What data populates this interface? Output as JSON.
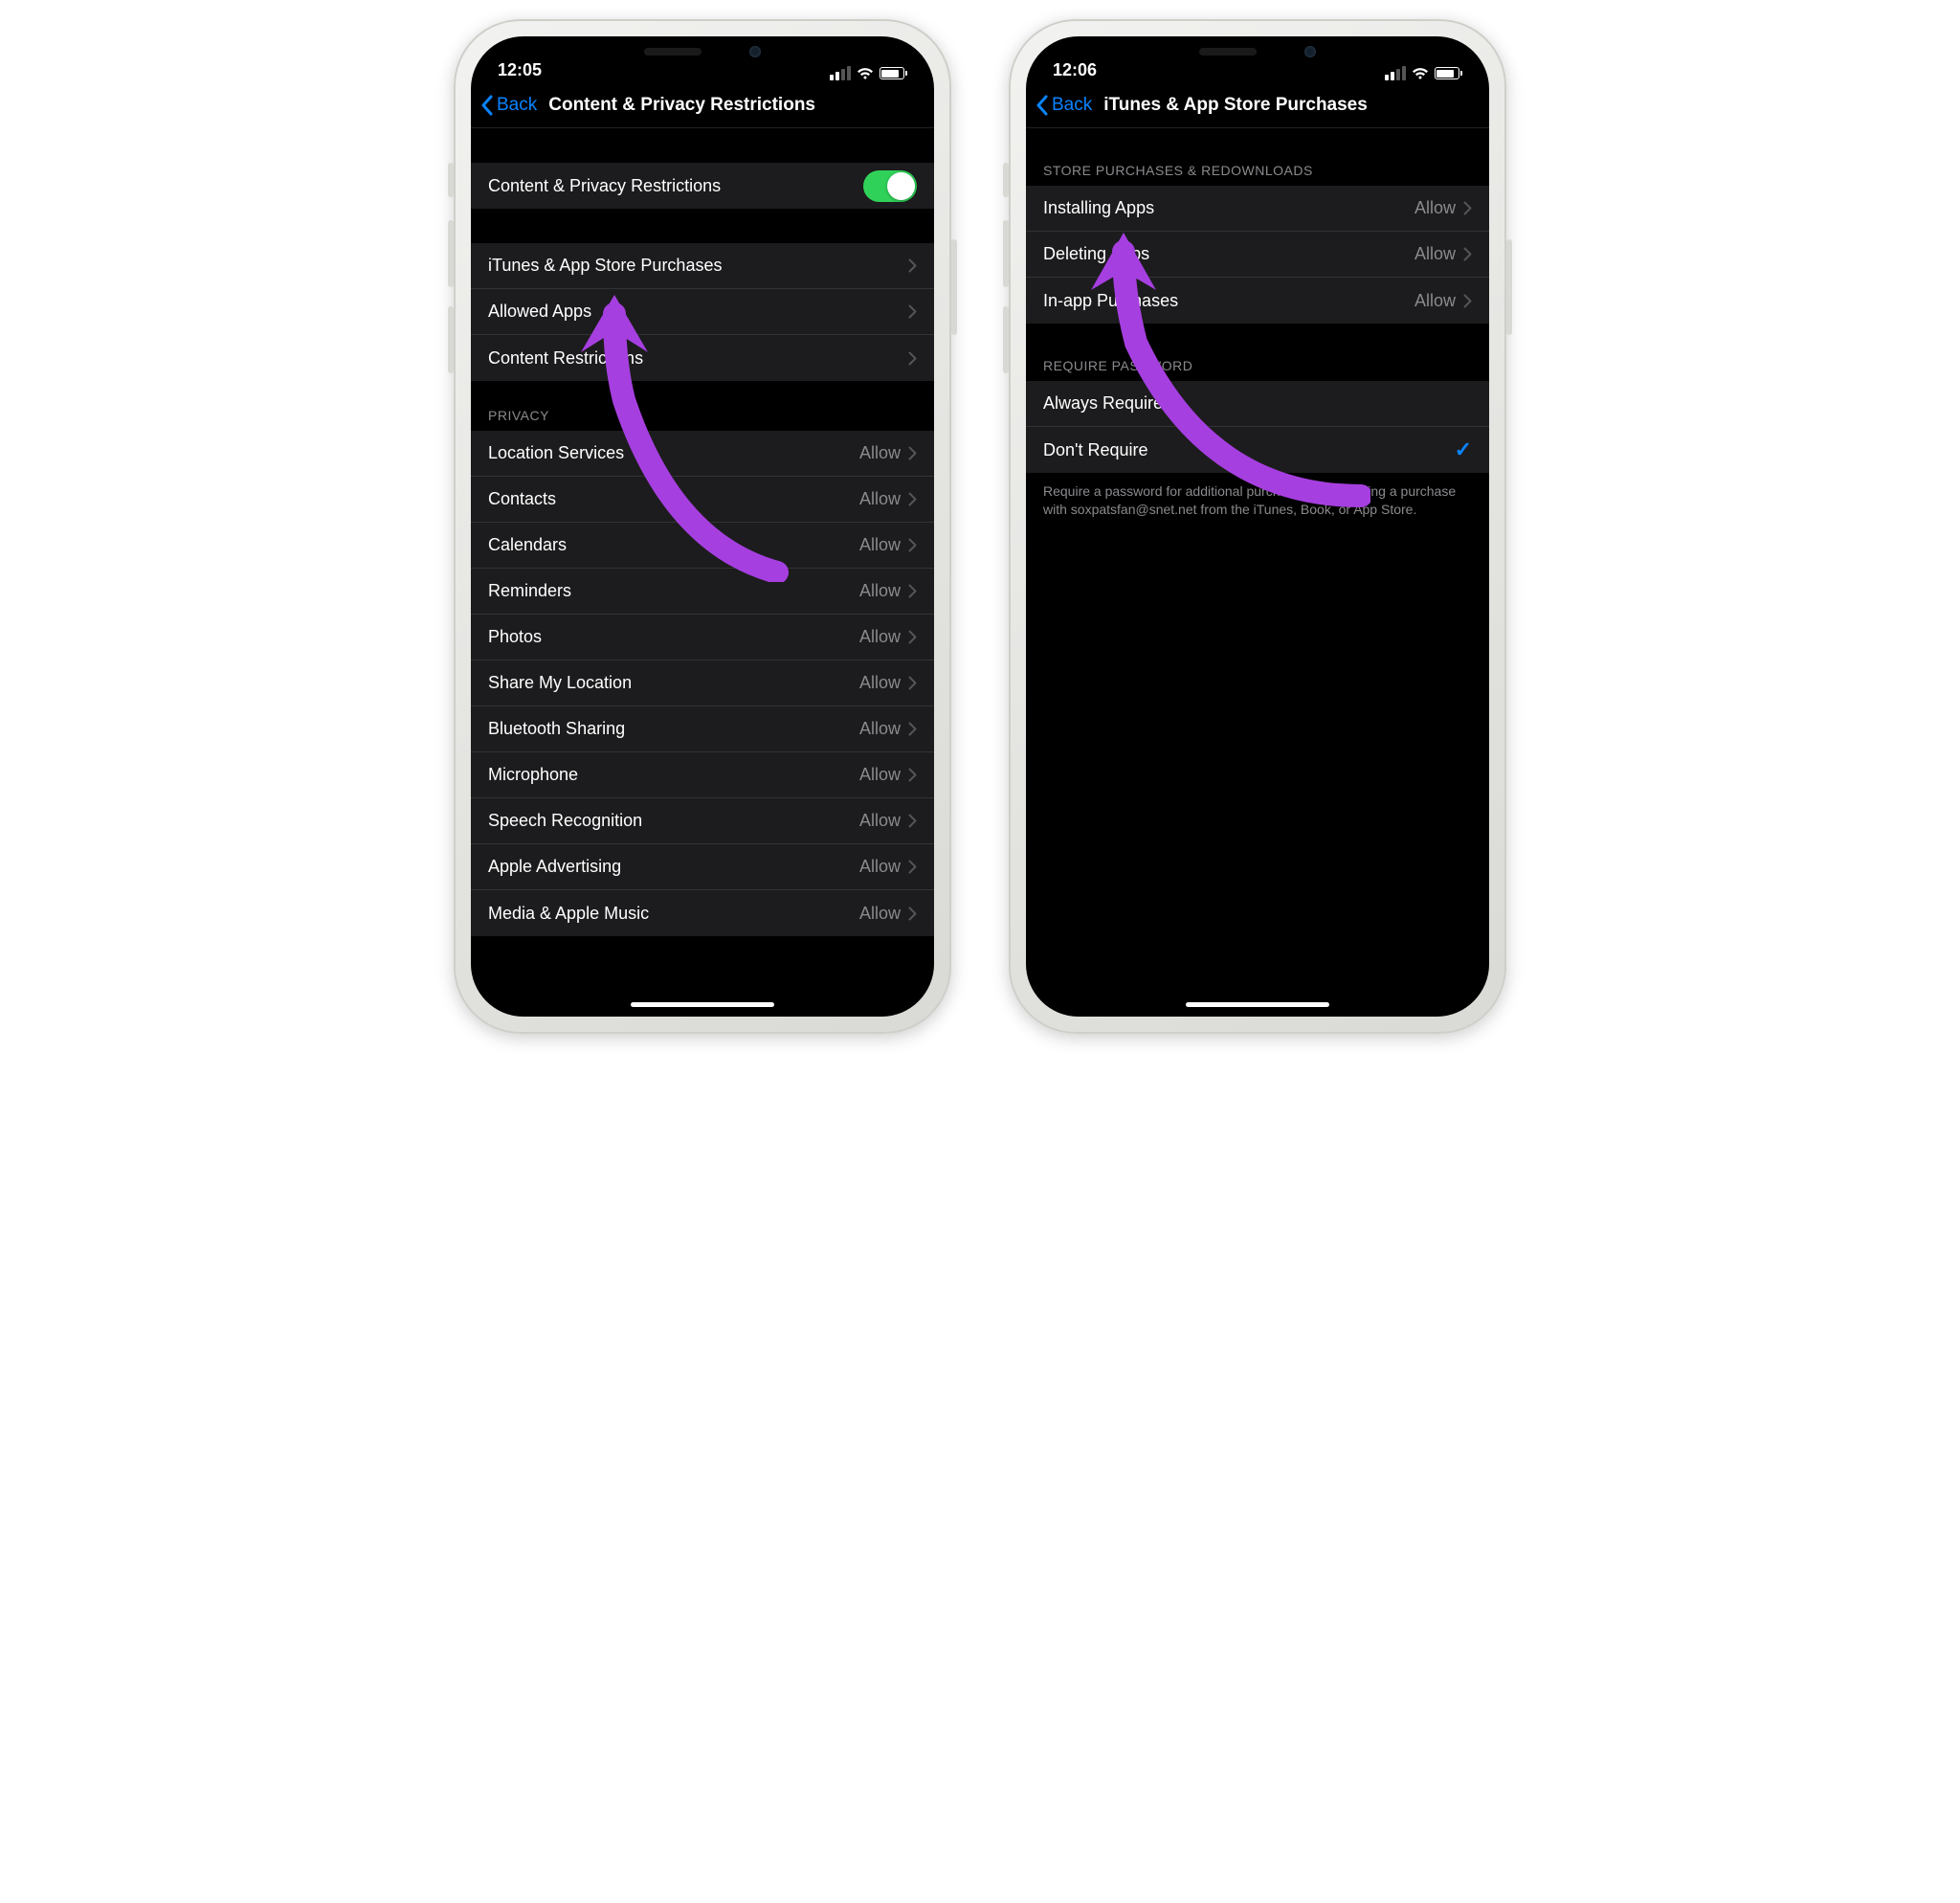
{
  "left": {
    "time": "12:05",
    "back": "Back",
    "title": "Content & Privacy Restrictions",
    "toggle_label": "Content & Privacy Restrictions",
    "toggle_on": true,
    "group2": [
      {
        "label": "iTunes & App Store Purchases"
      },
      {
        "label": "Allowed Apps"
      },
      {
        "label": "Content Restrictions"
      }
    ],
    "privacy_header": "PRIVACY",
    "privacy": [
      {
        "label": "Location Services",
        "value": "Allow"
      },
      {
        "label": "Contacts",
        "value": "Allow"
      },
      {
        "label": "Calendars",
        "value": "Allow"
      },
      {
        "label": "Reminders",
        "value": "Allow"
      },
      {
        "label": "Photos",
        "value": "Allow"
      },
      {
        "label": "Share My Location",
        "value": "Allow"
      },
      {
        "label": "Bluetooth Sharing",
        "value": "Allow"
      },
      {
        "label": "Microphone",
        "value": "Allow"
      },
      {
        "label": "Speech Recognition",
        "value": "Allow"
      },
      {
        "label": "Apple Advertising",
        "value": "Allow"
      },
      {
        "label": "Media & Apple Music",
        "value": "Allow"
      }
    ]
  },
  "right": {
    "time": "12:06",
    "back": "Back",
    "title": "iTunes & App Store Purchases",
    "store_header": "STORE PURCHASES & REDOWNLOADS",
    "store": [
      {
        "label": "Installing Apps",
        "value": "Allow"
      },
      {
        "label": "Deleting Apps",
        "value": "Allow"
      },
      {
        "label": "In-app Purchases",
        "value": "Allow"
      }
    ],
    "pw_header": "REQUIRE PASSWORD",
    "pw": [
      {
        "label": "Always Require",
        "checked": false
      },
      {
        "label": "Don't Require",
        "checked": true
      }
    ],
    "footer": "Require a password for additional purchases after making a purchase with soxpatsfan@snet.net from the iTunes, Book, or App Store."
  },
  "colors": {
    "accent": "#0a84ff",
    "toggle": "#30d158",
    "arrow": "#a63fe0"
  }
}
